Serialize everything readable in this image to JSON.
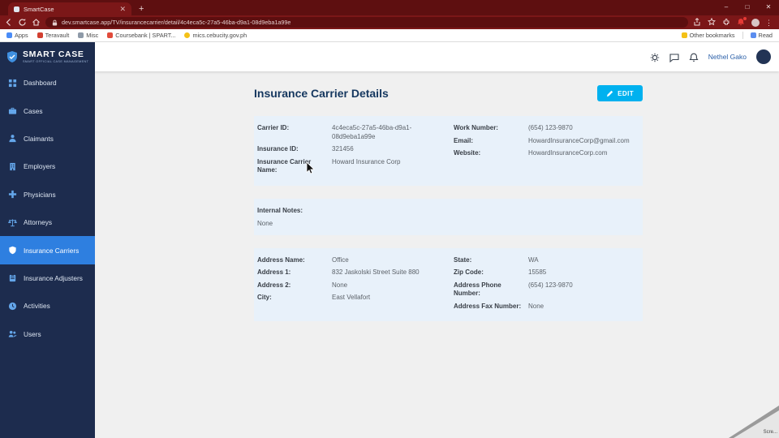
{
  "colors": {
    "accent": "#00b1ef",
    "sidebar_bg": "#1d2c4e",
    "sidebar_active": "#2e7fe0",
    "card_bg": "#e8f1fa",
    "browser_frame": "#5e0f10",
    "browser_toolbar": "#7b1718",
    "title_text": "#15375f"
  },
  "browser": {
    "tab_title": "SmartCase",
    "url": "dev.smartcase.app/TV/insurancecarrier/detail/4c4eca5c-27a5-46ba-d9a1-08d9eba1a99e",
    "bookmarks": [
      {
        "label": "Apps"
      },
      {
        "label": "Teravault"
      },
      {
        "label": "Misc"
      },
      {
        "label": "Coursebank | SPART..."
      },
      {
        "label": "mics.cebucity.gov.ph"
      }
    ],
    "other_bookmarks": "Other bookmarks",
    "reading_list": "Read"
  },
  "sidebar": {
    "logo_title": "SMART CASE",
    "logo_subtitle": "SMART OFFICIAL CASE MANAGEMENT",
    "items": [
      {
        "label": "Dashboard"
      },
      {
        "label": "Cases"
      },
      {
        "label": "Claimants"
      },
      {
        "label": "Employers"
      },
      {
        "label": "Physicians"
      },
      {
        "label": "Attorneys"
      },
      {
        "label": "Insurance Carriers"
      },
      {
        "label": "Insurance Adjusters"
      },
      {
        "label": "Activities"
      },
      {
        "label": "Users"
      }
    ]
  },
  "topbar": {
    "user_name": "Nethel Gako"
  },
  "main": {
    "title": "Insurance Carrier Details",
    "edit_label": "EDIT",
    "carrier_card": {
      "left": [
        {
          "label": "Carrier ID:",
          "value": "4c4eca5c-27a5-46ba-d9a1-08d9eba1a99e"
        },
        {
          "label": "Insurance ID:",
          "value": "321456"
        },
        {
          "label": "Insurance Carrier Name:",
          "value": "Howard Insurance Corp"
        }
      ],
      "right": [
        {
          "label": "Work Number:",
          "value": "(654) 123-9870"
        },
        {
          "label": "Email:",
          "value": "HowardInsuranceCorp@gmail.com"
        },
        {
          "label": "Website:",
          "value": "HowardInsuranceCorp.com"
        }
      ]
    },
    "notes_card": {
      "label": "Internal Notes:",
      "value": "None"
    },
    "address_card": {
      "left": [
        {
          "label": "Address Name:",
          "value": "Office"
        },
        {
          "label": "Address 1:",
          "value": "832 Jaskolski Street Suite 880"
        },
        {
          "label": "Address 2:",
          "value": "None"
        },
        {
          "label": "City:",
          "value": "East Vellafort"
        }
      ],
      "right": [
        {
          "label": "State:",
          "value": "WA"
        },
        {
          "label": "Zip Code:",
          "value": "15585"
        },
        {
          "label": "Address Phone Number:",
          "value": "(654) 123-9870"
        },
        {
          "label": "Address Fax Number:",
          "value": "None"
        }
      ]
    }
  },
  "overlay": {
    "corner_label": "Scre..."
  }
}
